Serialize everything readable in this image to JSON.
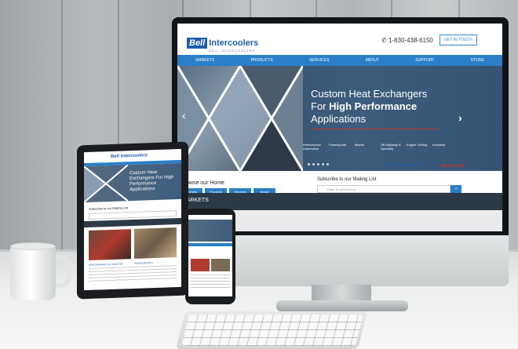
{
  "monitor": {
    "logo": {
      "bell": "Bell",
      "rest": "Intercoolers",
      "sub": "BELL INTERCOOLERS"
    },
    "phone": "1-830-438-6150",
    "cta": "GET IN TOUCH",
    "nav": [
      "MARKETS",
      "PRODUCTS",
      "SERVICES",
      "ABOUT",
      "SUPPORT",
      "STORE"
    ],
    "hero": {
      "title_line1": "Custom Heat Exchangers",
      "title_line2_prefix": "For ",
      "title_line2_bold": "High Performance",
      "title_line3": "Applications",
      "categories": [
        "Performance Automotive",
        "Powersports",
        "Marine",
        "Off-Highway & Specialty",
        "Engine Testing",
        "Industrial"
      ]
    },
    "browse": "Browse our Home",
    "tabs": [
      "Markets",
      "Products",
      "Services",
      "About"
    ],
    "subscribe": "Subscribe to our Mailing List",
    "email_placeholder": "Enter Email Address",
    "email_button": "›",
    "mini_logo": "Bell Intercoolers",
    "usa": "Made in USA",
    "markets_bar": "MARKETS"
  },
  "tablet": {
    "logo": "Bell Intercoolers",
    "title": "Custom Heat Exchangers For High Performance Applications",
    "subscribe": "Subscribe to our Mailing List",
    "captions": [
      "PERFORMANCE AUTOMOTIVE",
      "POWERSPORTS"
    ]
  },
  "colors": {
    "brand": "#1f5ea8",
    "nav": "#2a7fc8",
    "accent": "#c0392b"
  }
}
